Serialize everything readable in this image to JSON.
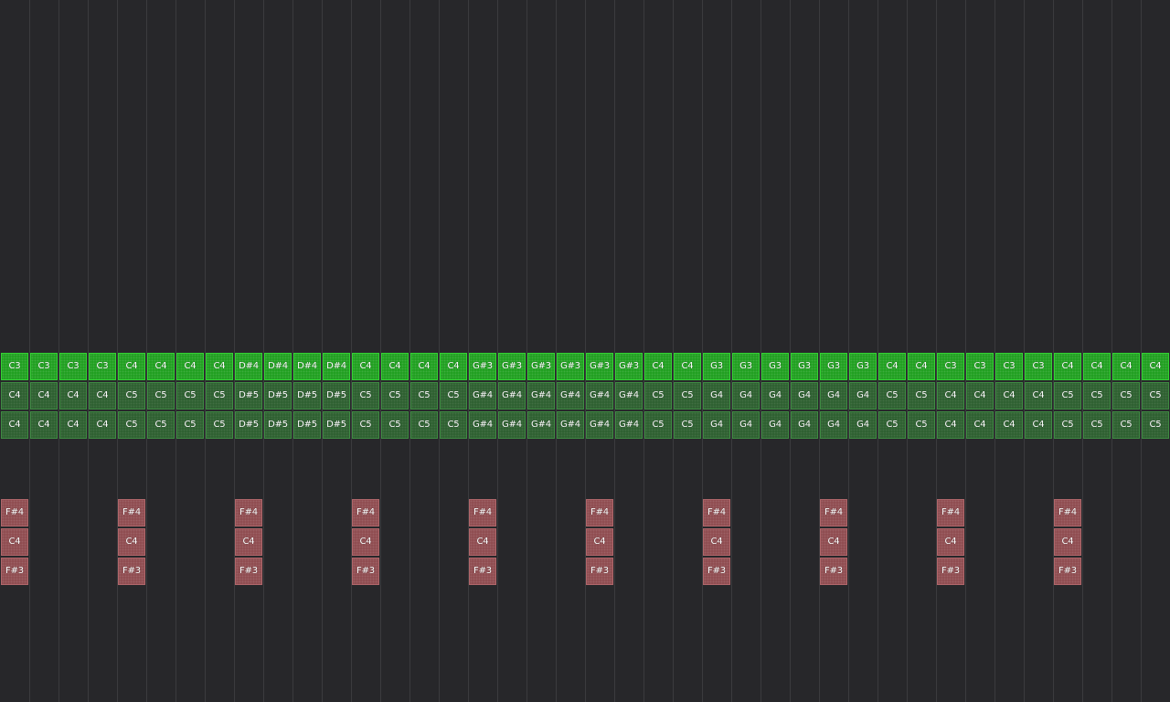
{
  "colors": {
    "background": "#27272a",
    "grid_line": "#3b3b3e",
    "main_note": "#1c9e1c",
    "harmony_note": "#2b5e2e",
    "percussion_note": "#8e4a4e",
    "note_text": "#ffffff"
  },
  "melody": {
    "row_main": [
      "C3",
      "C3",
      "C3",
      "C3",
      "C4",
      "C4",
      "C4",
      "C4",
      "D#4",
      "D#4",
      "D#4",
      "D#4",
      "C4",
      "C4",
      "C4",
      "C4",
      "G#3",
      "G#3",
      "G#3",
      "G#3",
      "G#3",
      "G#3",
      "C4",
      "C4",
      "G3",
      "G3",
      "G3",
      "G3",
      "G3",
      "G3",
      "C4",
      "C4",
      "C3",
      "C3",
      "C3",
      "C3",
      "C4",
      "C4",
      "C4",
      "C4"
    ],
    "row_harmony_1": [
      "C4",
      "C4",
      "C4",
      "C4",
      "C5",
      "C5",
      "C5",
      "C5",
      "D#5",
      "D#5",
      "D#5",
      "D#5",
      "C5",
      "C5",
      "C5",
      "C5",
      "G#4",
      "G#4",
      "G#4",
      "G#4",
      "G#4",
      "G#4",
      "C5",
      "C5",
      "G4",
      "G4",
      "G4",
      "G4",
      "G4",
      "G4",
      "C5",
      "C5",
      "C4",
      "C4",
      "C4",
      "C4",
      "C5",
      "C5",
      "C5",
      "C5"
    ],
    "row_harmony_2": [
      "C4",
      "C4",
      "C4",
      "C4",
      "C5",
      "C5",
      "C5",
      "C5",
      "D#5",
      "D#5",
      "D#5",
      "D#5",
      "C5",
      "C5",
      "C5",
      "C5",
      "G#4",
      "G#4",
      "G#4",
      "G#4",
      "G#4",
      "G#4",
      "C5",
      "C5",
      "G4",
      "G4",
      "G4",
      "G4",
      "G4",
      "G4",
      "C5",
      "C5",
      "C4",
      "C4",
      "C4",
      "C4",
      "C5",
      "C5",
      "C5",
      "C5"
    ]
  },
  "percussion": {
    "columns": [
      0,
      4,
      8,
      12,
      16,
      20,
      24,
      28,
      32,
      36
    ],
    "row_top": "F#4",
    "row_middle": "C4",
    "row_bottom": "F#3"
  }
}
